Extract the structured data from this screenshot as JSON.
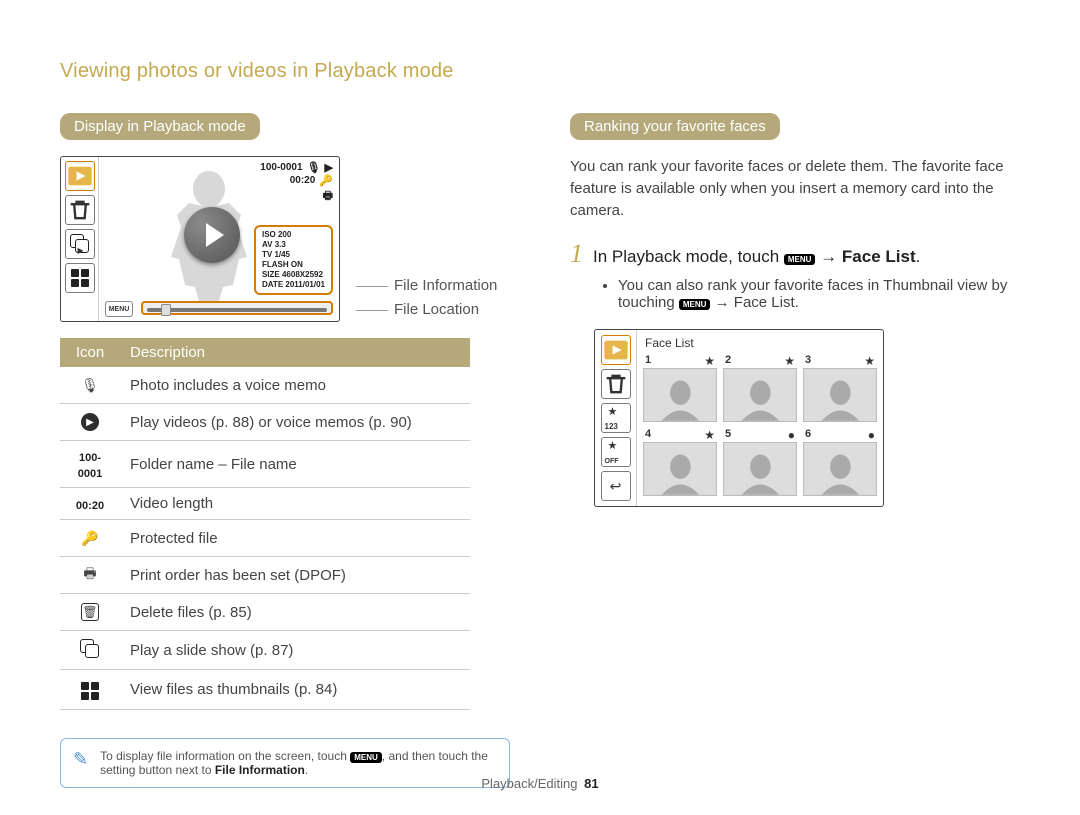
{
  "header": {
    "title": "Viewing photos or videos in Playback mode"
  },
  "left": {
    "section_title": "Display in Playback mode",
    "screen": {
      "folder_file": "100-0001",
      "video_length": "00:20",
      "metabox": {
        "iso_label": "ISO",
        "iso": "200",
        "av_label": "AV",
        "av": "3.3",
        "tv_label": "TV",
        "tv": "1/45",
        "flash_label": "FLASH",
        "flash": "ON",
        "size_label": "SIZE",
        "size": "4608X2592",
        "date_label": "DATE",
        "date": "2011/01/01"
      },
      "menu_label": "MENU"
    },
    "leaders": {
      "file_information": "File Information",
      "file_location": "File Location"
    },
    "table": {
      "h_icon": "Icon",
      "h_desc": "Description",
      "rows": [
        {
          "icon": "voice-memo",
          "text": "Photo includes a voice memo"
        },
        {
          "icon": "play-circle",
          "text": "Play videos (p. 88) or voice memos (p. 90)"
        },
        {
          "icon": "folder-file",
          "text": "Folder name – File name"
        },
        {
          "icon": "video-length",
          "text": "Video length"
        },
        {
          "icon": "lock",
          "text": "Protected file"
        },
        {
          "icon": "printer",
          "text": "Print order has been set (DPOF)"
        },
        {
          "icon": "trash",
          "text": "Delete files (p. 85)"
        },
        {
          "icon": "slideshow",
          "text": "Play a slide show (p. 87)"
        },
        {
          "icon": "thumbnails",
          "text": "View files as thumbnails (p. 84)"
        }
      ],
      "row_icon_text": {
        "folder_file": "100-0001",
        "video_length": "00:20"
      }
    },
    "tip": {
      "pre": "To display file information on the screen, touch ",
      "menu_key": "MENU",
      "mid": ", and then touch the setting button next to ",
      "strong": "File Information",
      "post": "."
    }
  },
  "right": {
    "section_title": "Ranking your favorite faces",
    "intro": "You can rank your favorite faces or delete them. The favorite face feature is available only when you insert a memory card into the camera.",
    "step1": {
      "num": "1",
      "pre": "In Playback mode, touch ",
      "menu_key": "MENU",
      "arrow": " → ",
      "bold": "Face List",
      "post": "."
    },
    "sub": {
      "pre": "You can also rank your favorite faces in Thumbnail view by touching ",
      "menu_key": "MENU",
      "arrow": " → ",
      "bold": "Face List",
      "post": "."
    },
    "face_screen": {
      "title": "Face List",
      "rank_btn": "123",
      "off_btn": "OFF",
      "cells": [
        {
          "n": "1",
          "mark": "star"
        },
        {
          "n": "2",
          "mark": "star"
        },
        {
          "n": "3",
          "mark": "star"
        },
        {
          "n": "4",
          "mark": "star"
        },
        {
          "n": "5",
          "mark": "dot"
        },
        {
          "n": "6",
          "mark": "dot"
        }
      ]
    }
  },
  "footer": {
    "section": "Playback/Editing",
    "page": "81"
  }
}
